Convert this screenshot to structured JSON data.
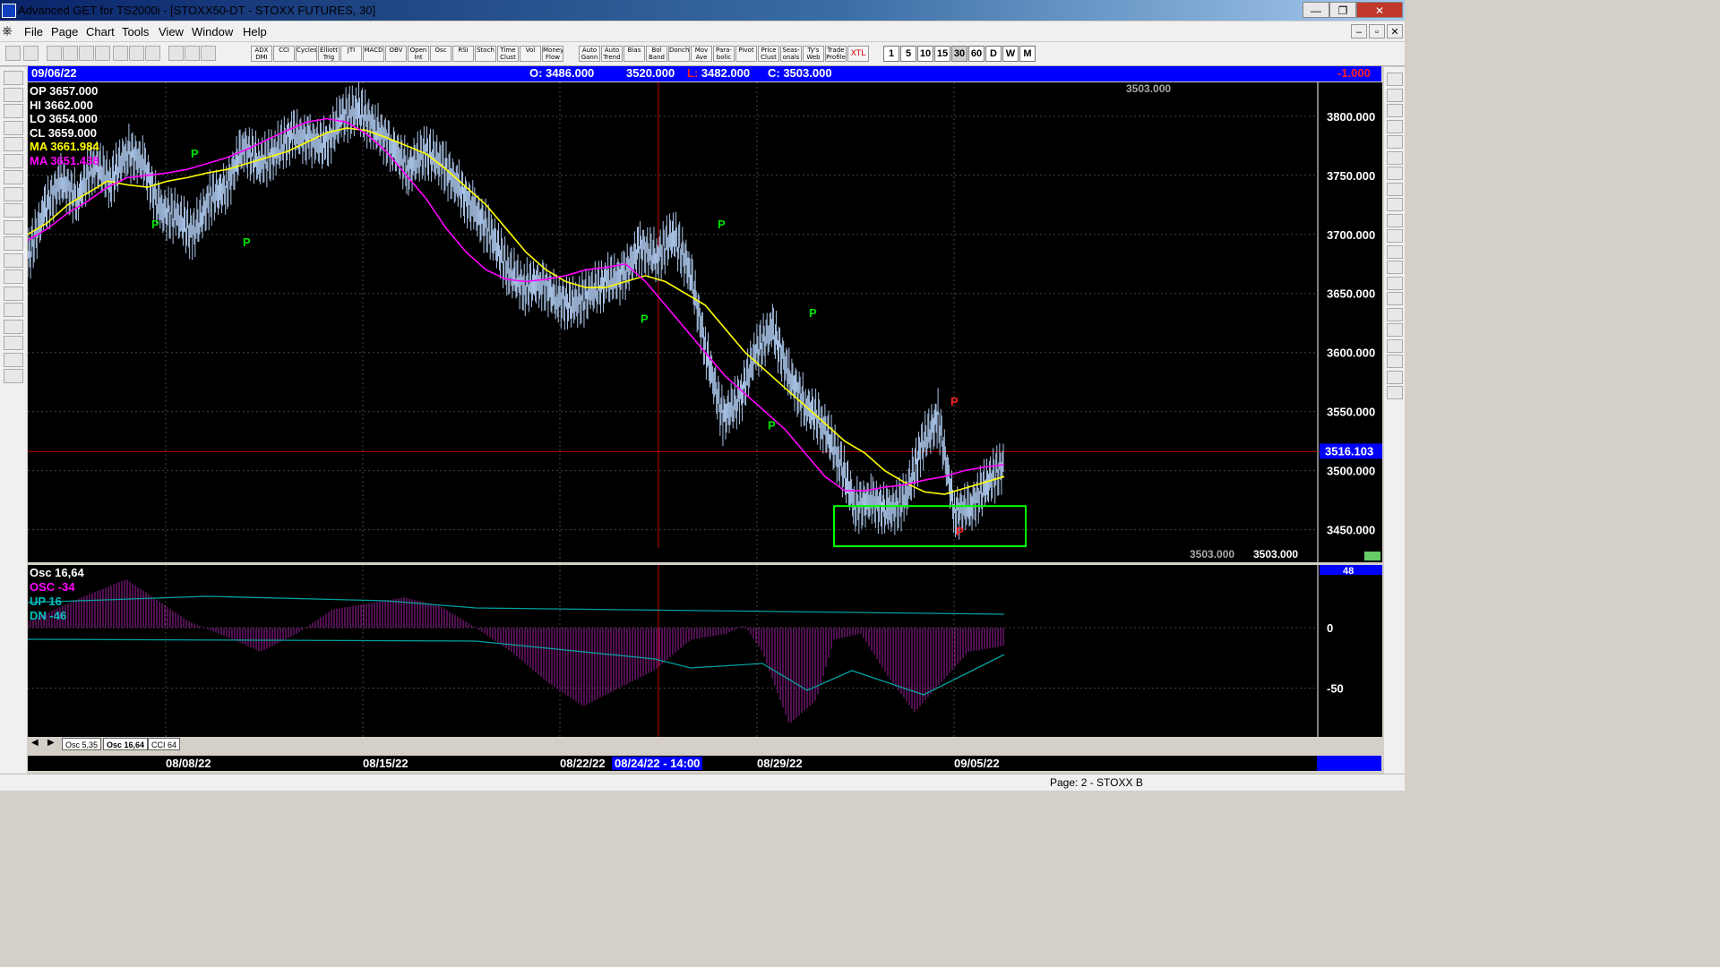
{
  "window": {
    "title": "Advanced GET for TS2000i - [STOXX50-DT - STOXX FUTURES, 30]",
    "min": "—",
    "max": "❐",
    "close": "✕"
  },
  "menu": [
    "File",
    "Page",
    "Chart",
    "Tools",
    "View",
    "Window",
    "Help"
  ],
  "mdi": {
    "min": "–",
    "restore": "▫",
    "close": "✕"
  },
  "toolbar": {
    "indicators": [
      "ADX DMI",
      "CCI",
      "Cycles",
      "Elliott Trig",
      "JTI",
      "MACD",
      "OBV",
      "Open Int",
      "Osc",
      "RSI",
      "Stoch",
      "Time Clust",
      "Vol",
      "Money Flow"
    ],
    "tools": [
      "Auto Gann",
      "Auto Trend",
      "Bias",
      "Bol Band",
      "Donch",
      "Mov Ave",
      "Para-bolic",
      "Pivot",
      "Price Clust",
      "Seas-onals",
      "Ty's Web",
      "Trade Profile",
      "XTL"
    ],
    "timeframes": [
      "1",
      "5",
      "10",
      "15",
      "30",
      "60",
      "D",
      "W",
      "M"
    ]
  },
  "infobar": {
    "date": "09/06/22",
    "open": "O: 3486.000",
    "high": "3520.000",
    "low": "L: 3482.000",
    "close": "C: 3503.000",
    "change": "-1.000"
  },
  "ohlc_box": [
    {
      "label": "OP 3657.000",
      "color": "#ffffff"
    },
    {
      "label": "HI 3662.000",
      "color": "#ffffff"
    },
    {
      "label": "LO 3654.000",
      "color": "#ffffff"
    },
    {
      "label": "CL 3659.000",
      "color": "#ffffff"
    },
    {
      "label": "MA 3661.984",
      "color": "#ffff00"
    },
    {
      "label": "MA 3651.438",
      "color": "#ff00ff"
    }
  ],
  "price_axis": {
    "labels": [
      "3800.000",
      "3750.000",
      "3700.000",
      "3650.000",
      "3600.000",
      "3550.000",
      "3500.000",
      "3450.000"
    ],
    "current": "3516.103",
    "ladder": [
      "3503.000",
      "3503.000",
      "3503.000"
    ]
  },
  "pivots": [
    {
      "label": "P",
      "color": "#00e000"
    },
    {
      "label": "P",
      "color": "#ff2020"
    }
  ],
  "osc_panel": {
    "title": "Osc 16,64",
    "lines": [
      {
        "label": "OSC -34",
        "color": "#ff00ff"
      },
      {
        "label": "UP  16",
        "color": "#00c0c0"
      },
      {
        "label": "DN  -46",
        "color": "#00c0c0"
      }
    ],
    "axis": [
      "0",
      "-50"
    ],
    "top_value": "48"
  },
  "tabs": [
    "Osc 5,35",
    "Osc 16,64",
    "CCI 64"
  ],
  "dates": [
    "08/08/22",
    "08/15/22",
    "08/22/22",
    "08/24/22 - 14:00",
    "08/29/22",
    "09/05/22"
  ],
  "status": "Page: 2 - STOXX B",
  "chart_data": {
    "type": "line",
    "title": "STOXX50-DT - STOXX FUTURES, 30",
    "ylim": [
      3430,
      3820
    ],
    "x": [
      "08/08/22",
      "08/15/22",
      "08/22/22",
      "08/29/22",
      "09/05/22"
    ],
    "series": [
      {
        "name": "price",
        "values": [
          3680,
          3720,
          3745,
          3730,
          3760,
          3745,
          3770,
          3760,
          3720,
          3715,
          3700,
          3730,
          3740,
          3775,
          3760,
          3770,
          3785,
          3780,
          3775,
          3800,
          3805,
          3790,
          3775,
          3755,
          3770,
          3760,
          3740,
          3720,
          3700,
          3670,
          3655,
          3660,
          3645,
          3640,
          3650,
          3660,
          3665,
          3690,
          3680,
          3700,
          3670,
          3600,
          3545,
          3560,
          3600,
          3620,
          3580,
          3555,
          3540,
          3510,
          3470,
          3475,
          3465,
          3475,
          3520,
          3545,
          3465,
          3470,
          3490,
          3505
        ]
      },
      {
        "name": "MA",
        "values": [
          3700,
          3710,
          3725,
          3735,
          3745,
          3742,
          3740,
          3745,
          3748,
          3752,
          3755,
          3760,
          3765,
          3770,
          3778,
          3786,
          3790,
          3788,
          3782,
          3775,
          3768,
          3755,
          3740,
          3725,
          3705,
          3685,
          3670,
          3660,
          3655,
          3655,
          3660,
          3665,
          3660,
          3650,
          3640,
          3620,
          3600,
          3585,
          3570,
          3555,
          3540,
          3525,
          3515,
          3500,
          3490,
          3482,
          3480,
          3485,
          3490,
          3495
        ]
      },
      {
        "name": "MA2",
        "values": [
          3695,
          3705,
          3718,
          3728,
          3740,
          3748,
          3750,
          3752,
          3755,
          3760,
          3765,
          3772,
          3780,
          3788,
          3795,
          3798,
          3795,
          3785,
          3770,
          3750,
          3730,
          3705,
          3685,
          3670,
          3662,
          3660,
          3662,
          3665,
          3670,
          3672,
          3675,
          3660,
          3640,
          3620,
          3600,
          3580,
          3565,
          3550,
          3535,
          3515,
          3495,
          3483,
          3483,
          3486,
          3488,
          3492,
          3495,
          3500,
          3503,
          3505
        ]
      }
    ]
  }
}
